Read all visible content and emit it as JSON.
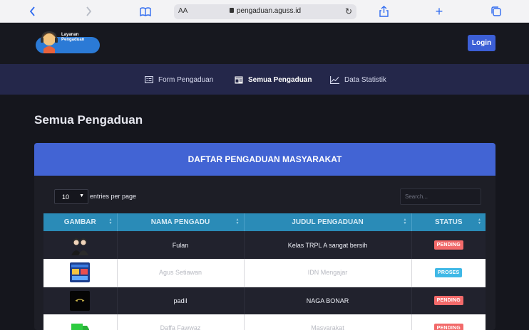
{
  "browser": {
    "text_size_label": "AA",
    "url": "pengaduan.aguss.id"
  },
  "header": {
    "logo_line1": "Layanan",
    "logo_line2": "Pengaduan",
    "login_label": "Login"
  },
  "nav": {
    "items": [
      {
        "label": "Form Pengaduan",
        "icon": "form-icon"
      },
      {
        "label": "Semua Pengaduan",
        "icon": "list-icon",
        "active": true
      },
      {
        "label": "Data Statistik",
        "icon": "chart-line-icon"
      }
    ]
  },
  "page": {
    "title": "Semua Pengaduan"
  },
  "card": {
    "title": "DAFTAR PENGADUAN MASYARAKAT",
    "entries_value": "10",
    "entries_label": "entries per page",
    "search_placeholder": "Search..."
  },
  "table": {
    "headers": [
      "GAMBAR",
      "NAMA PENGADU",
      "JUDUL PENGADUAN",
      "STATUS"
    ],
    "rows": [
      {
        "image": "two-people-thumbnail",
        "nama": "Fulan",
        "judul": "Kelas TRPL A sangat bersih",
        "status": "PENDING"
      },
      {
        "image": "blue-poster-thumbnail",
        "nama": "Agus Setiawan",
        "judul": "IDN Mengajar",
        "status": "PROSES"
      },
      {
        "image": "dark-logo-thumbnail",
        "nama": "padil",
        "judul": "NAGA BONAR",
        "status": "PENDING"
      },
      {
        "image": "green-truck-thumbnail",
        "nama": "Daffa Fawwaz",
        "judul": "Masyarakat",
        "status": "PENDING"
      }
    ]
  },
  "colors": {
    "header_bg": "#17181f",
    "nav_bg": "#24274a",
    "card_header": "#4264d4",
    "table_header": "#2a8bb7",
    "pending": "#f26a6a",
    "proses": "#3fb8e6",
    "login": "#3c5fd6"
  }
}
